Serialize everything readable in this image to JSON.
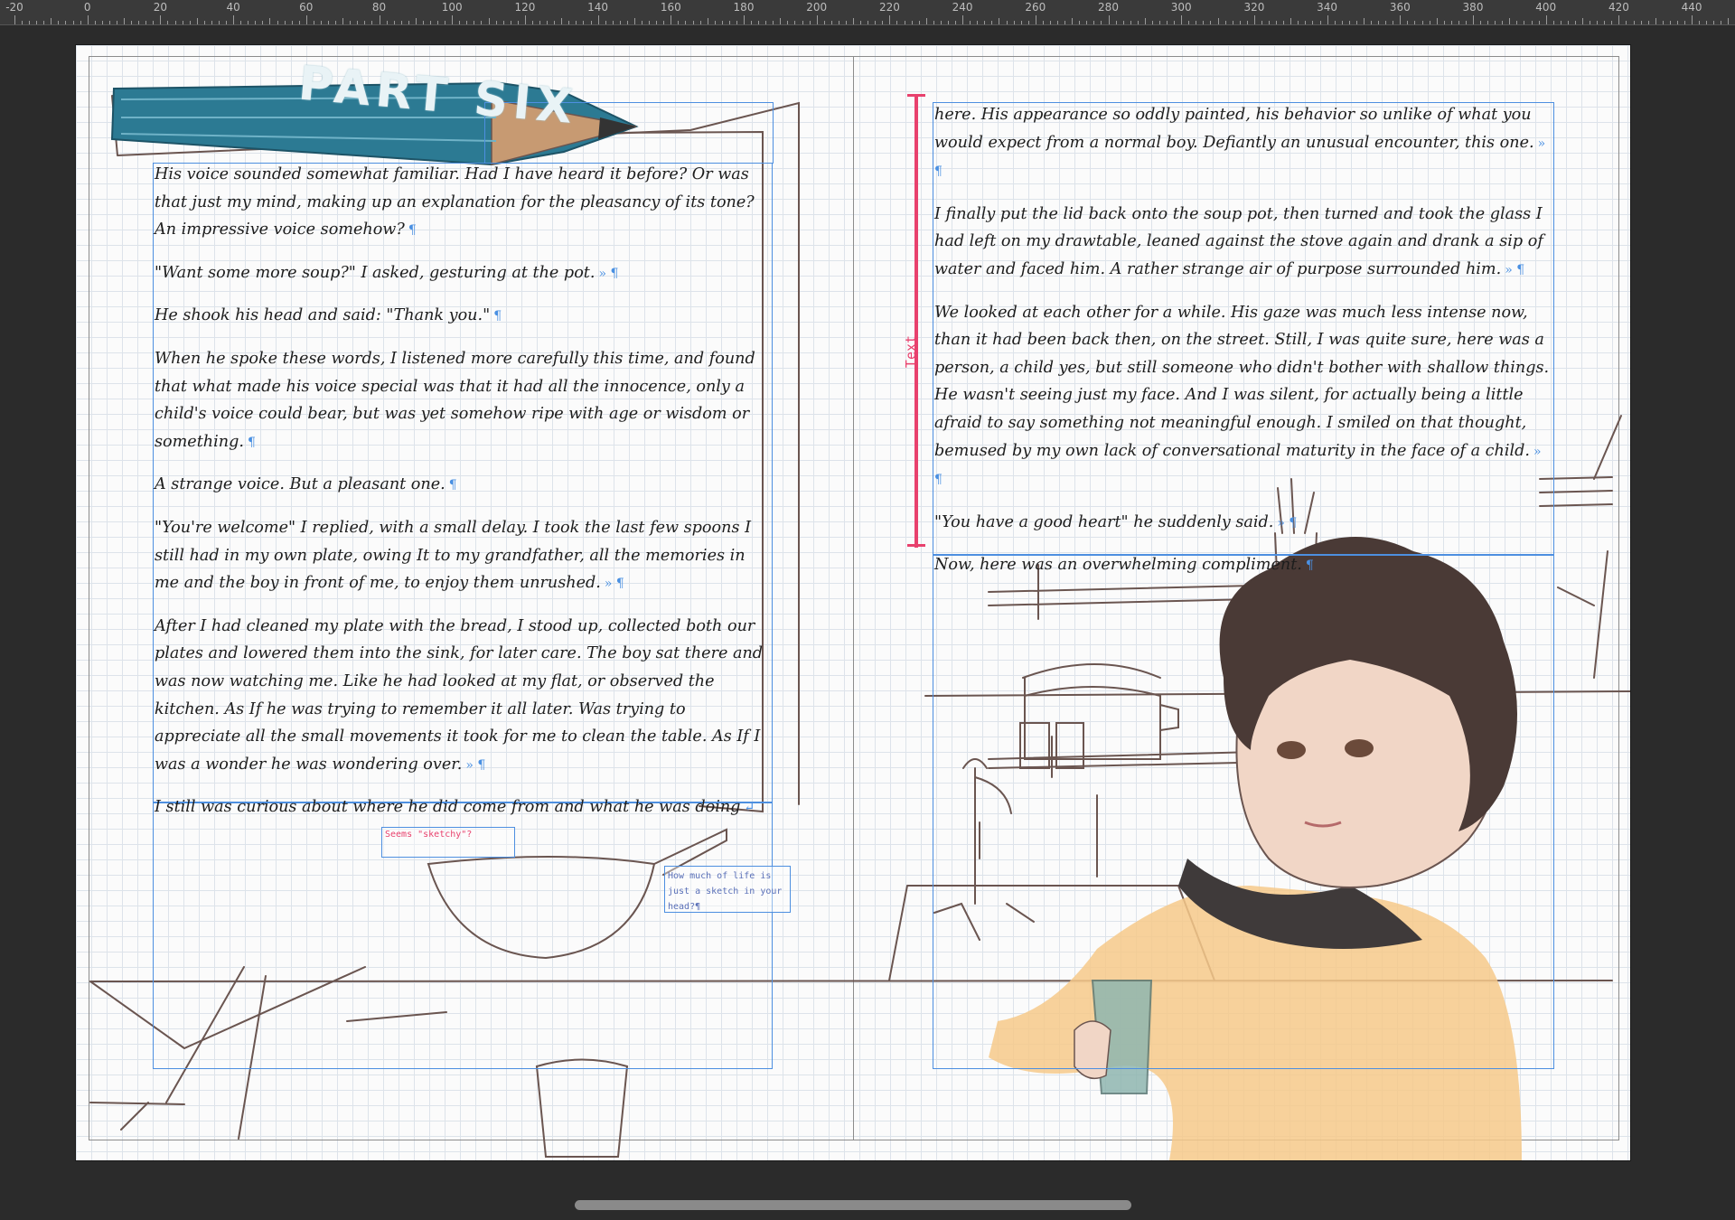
{
  "ruler": {
    "labels": [
      "-20",
      "0",
      "20",
      "40",
      "60",
      "80",
      "100",
      "120",
      "140",
      "160",
      "180",
      "200",
      "220",
      "240",
      "260",
      "280",
      "300",
      "320",
      "340",
      "360",
      "380",
      "400",
      "420",
      "440"
    ]
  },
  "title": {
    "text": "PART SIX"
  },
  "textpath": {
    "label": "Text"
  },
  "notes": {
    "pink": "Seems \"sketchy\"?",
    "blue": "How much of life is just a sketch in your head?¶"
  },
  "left_page": {
    "paragraphs": [
      "His voice sounded somewhat familiar. Had I have heard it before? Or was that just my mind, making up an explanation for the pleasancy of its tone? An impressive voice somehow?",
      "\"Want some more soup?\" I asked, gesturing at the pot.",
      "He shook his head and said: \"Thank you.\"",
      "When he spoke these words, I listened more carefully this time, and found that what made his voice special was that it had all the innocence, only a child's voice could bear, but was yet somehow ripe with age or wisdom or something.",
      "A strange voice. But a pleasant one.",
      "\"You're welcome\" I replied, with a small delay. I took the last few spoons I still had in my own plate, owing It to my grandfather, all the memories in me and the boy in front of me, to enjoy them unrushed.",
      "After I had cleaned my plate with the bread, I stood up, collected both our plates and lowered them into the sink, for later care. The boy sat there and was now watching me. Like he had looked at my flat, or observed the kitchen. As If he was trying to remember it all later. Was trying to appreciate all the small movements it took for me to clean the table. As If I was a wonder he was wondering over.",
      "I still was curious about where he did come from and what he was doing"
    ],
    "marks": [
      "¶",
      "» ¶",
      "¶",
      "¶",
      "¶",
      "» ¶",
      "» ¶",
      "↵"
    ]
  },
  "right_page": {
    "paragraphs": [
      "here. His appearance so oddly painted, his behavior so unlike of what you would expect from a normal boy. Defiantly an unusual encounter, this one.",
      "I finally put the lid back onto the soup pot, then turned and took the glass I had left on my drawtable, leaned against the stove again and drank a sip of water and faced him. A rather strange air of purpose surrounded him.",
      "We looked at each other for a while. His gaze was much less intense now, than it had been back then, on the street. Still, I was quite sure, here was a person, a child yes, but still someone who didn't bother with shallow things. He wasn't seeing just my face. And I was silent, for actually being a little afraid to say something not meaningful enough. I smiled on that thought, bemused by my own lack of conversational maturity in the face of a child.",
      "\"You have a good heart\" he suddenly said.",
      "Now, here was an overwhelming compliment."
    ],
    "marks": [
      "» ¶",
      "» ¶",
      "» ¶",
      "» ¶",
      "¶"
    ]
  },
  "colors": {
    "frame": "#4d8fe0",
    "textpath": "#e8416d",
    "pencil": "#2c7a93",
    "sweater": "#f6c98a",
    "hair": "#4a3a36",
    "scarf": "#3f3a3a"
  }
}
